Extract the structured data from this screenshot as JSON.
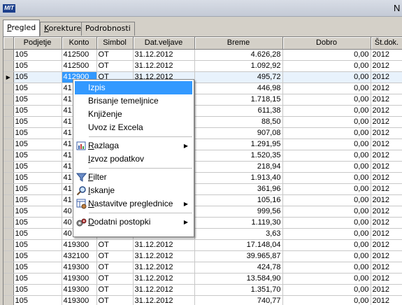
{
  "window": {
    "title": "N"
  },
  "tabs": [
    {
      "label_u": "P",
      "label_rest": "regled",
      "active": true
    },
    {
      "label_u": "K",
      "label_rest": "orekture",
      "active": false
    },
    {
      "label_u": "",
      "label_rest": "Podrobnosti",
      "active": false
    }
  ],
  "grid": {
    "columns": [
      "Podjetje",
      "Konto",
      "Simbol",
      "Dat.veljave",
      "Breme",
      "Dobro",
      "Št.dok."
    ],
    "selected_row_index": 2,
    "rows": [
      [
        "105",
        "412500",
        "OT",
        "31.12.2012",
        "4.626,28",
        "0,00",
        "2012"
      ],
      [
        "105",
        "412500",
        "OT",
        "31.12.2012",
        "1.092,92",
        "0,00",
        "2012"
      ],
      [
        "105",
        "412900",
        "OT",
        "31.12.2012",
        "495,72",
        "0,00",
        "2012"
      ],
      [
        "105",
        "41",
        "",
        "",
        "446,98",
        "0,00",
        "2012"
      ],
      [
        "105",
        "41",
        "",
        "",
        "1.718,15",
        "0,00",
        "2012"
      ],
      [
        "105",
        "41",
        "",
        "",
        "611,38",
        "0,00",
        "2012"
      ],
      [
        "105",
        "41",
        "",
        "",
        "88,50",
        "0,00",
        "2012"
      ],
      [
        "105",
        "41",
        "",
        "",
        "907,08",
        "0,00",
        "2012"
      ],
      [
        "105",
        "41",
        "",
        "",
        "1.291,95",
        "0,00",
        "2012"
      ],
      [
        "105",
        "41",
        "",
        "",
        "1.520,35",
        "0,00",
        "2012"
      ],
      [
        "105",
        "41",
        "",
        "",
        "218,94",
        "0,00",
        "2012"
      ],
      [
        "105",
        "41",
        "",
        "",
        "1.913,40",
        "0,00",
        "2012"
      ],
      [
        "105",
        "41",
        "",
        "",
        "361,96",
        "0,00",
        "2012"
      ],
      [
        "105",
        "41",
        "",
        "",
        "105,16",
        "0,00",
        "2012"
      ],
      [
        "105",
        "40",
        "",
        "",
        "999,56",
        "0,00",
        "2012"
      ],
      [
        "105",
        "40",
        "",
        "",
        "1.119,30",
        "0,00",
        "2012"
      ],
      [
        "105",
        "40",
        "",
        "",
        "3,63",
        "0,00",
        "2012"
      ],
      [
        "105",
        "419300",
        "OT",
        "31.12.2012",
        "17.148,04",
        "0,00",
        "2012"
      ],
      [
        "105",
        "432100",
        "OT",
        "31.12.2012",
        "39.965,87",
        "0,00",
        "2012"
      ],
      [
        "105",
        "419300",
        "OT",
        "31.12.2012",
        "424,78",
        "0,00",
        "2012"
      ],
      [
        "105",
        "419300",
        "OT",
        "31.12.2012",
        "13.584,90",
        "0,00",
        "2012"
      ],
      [
        "105",
        "419300",
        "OT",
        "31.12.2012",
        "1.351,70",
        "0,00",
        "2012"
      ],
      [
        "105",
        "419300",
        "OT",
        "31.12.2012",
        "740,77",
        "0,00",
        "2012"
      ]
    ]
  },
  "context_menu": {
    "items": [
      {
        "label": "Izpis",
        "icon": "",
        "highlighted": true,
        "submenu": false
      },
      {
        "label": "Brisanje temeljnice",
        "icon": "",
        "submenu": false
      },
      {
        "label": "Knjiženje",
        "icon": "",
        "submenu": false
      },
      {
        "label": "Uvoz iz Excela",
        "icon": "",
        "submenu": false
      },
      {
        "sep": true
      },
      {
        "label_u": "R",
        "label_rest": "azlaga",
        "icon": "report-icon",
        "submenu": true
      },
      {
        "label_u": "I",
        "label_rest": "zvoz podatkov",
        "icon": "",
        "submenu": false
      },
      {
        "sep": true
      },
      {
        "label_u": "F",
        "label_rest": "ilter",
        "icon": "filter-icon",
        "submenu": false
      },
      {
        "label_u": "I",
        "label_rest": "skanje",
        "icon": "search-icon",
        "submenu": false
      },
      {
        "label_u": "N",
        "label_rest": "astavitve preglednice",
        "icon": "grid-settings-icon",
        "submenu": true
      },
      {
        "sep": true
      },
      {
        "label_u": "D",
        "label_rest": "odatni postopki",
        "icon": "gears-icon",
        "submenu": true
      }
    ]
  },
  "colors": {
    "highlight": "#3399ff",
    "selected_row": "#e8f2fc",
    "chrome": "#d4d0c8"
  }
}
